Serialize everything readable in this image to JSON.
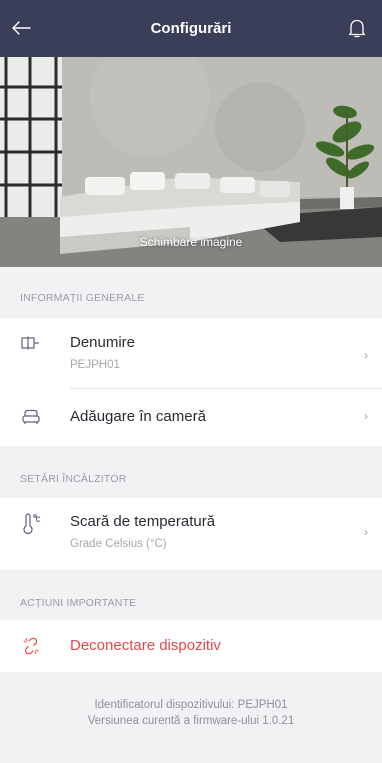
{
  "header": {
    "title": "Configurări",
    "back_icon": "arrow-left-icon",
    "bell_icon": "bell-icon"
  },
  "hero": {
    "caption": "Schimbare imagine"
  },
  "sections": {
    "general": {
      "title": "INFORMAȚII GENERALE",
      "name_label": "Denumire",
      "name_value": "PEJPH01",
      "room_label": "Adăugare în cameră"
    },
    "heater": {
      "title": "SETĂRI ÎNCĂLZITOR",
      "scale_label": "Scară de temperatură",
      "scale_value": "Grade Celsius (°C)"
    },
    "actions": {
      "title": "ACȚIUNI IMPORTANTE",
      "disconnect_label": "Deconectare dispozitiv"
    }
  },
  "footer": {
    "device_id": "Identificatorul dispozitivului: PEJPH01",
    "firmware": "Versiunea curentă a firmware-ului 1.0.21"
  },
  "colors": {
    "header_bg": "#3b3e58",
    "danger": "#e8474a",
    "page_bg": "#f2f2f4"
  }
}
